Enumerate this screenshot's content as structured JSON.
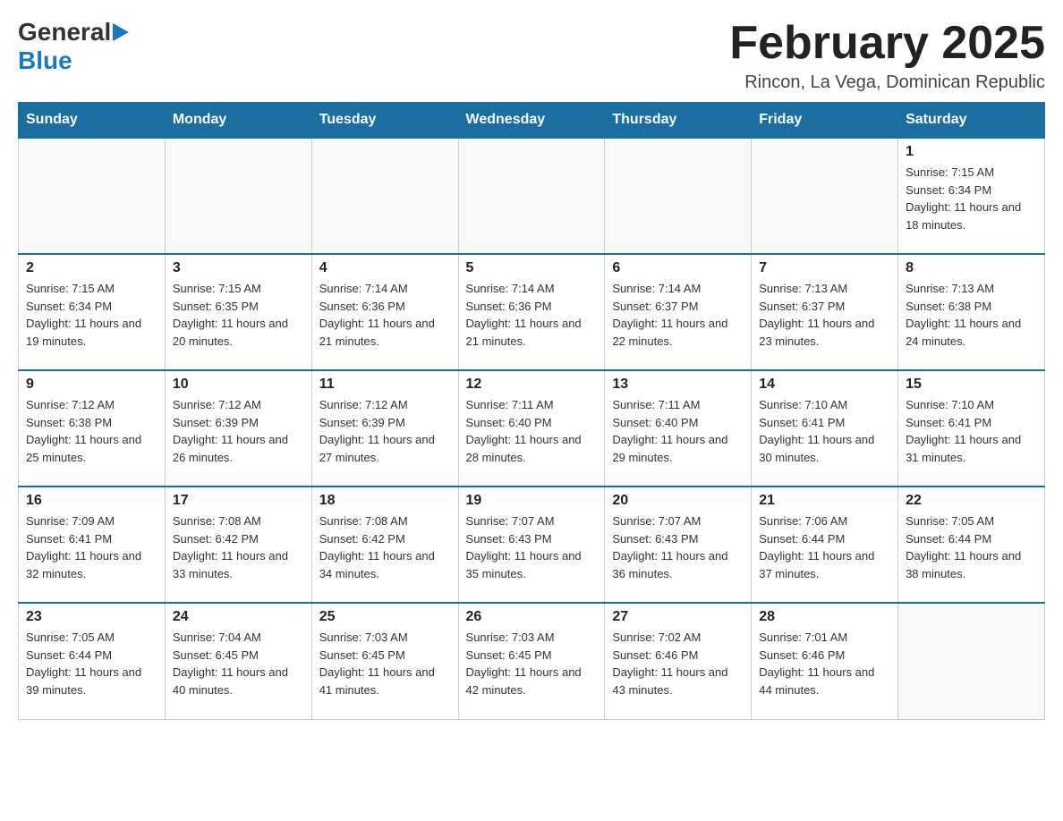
{
  "header": {
    "logo_general": "General",
    "logo_blue": "Blue",
    "main_title": "February 2025",
    "subtitle": "Rincon, La Vega, Dominican Republic"
  },
  "calendar": {
    "days_of_week": [
      "Sunday",
      "Monday",
      "Tuesday",
      "Wednesday",
      "Thursday",
      "Friday",
      "Saturday"
    ],
    "weeks": [
      [
        {
          "day": "",
          "sunrise": "",
          "sunset": "",
          "daylight": ""
        },
        {
          "day": "",
          "sunrise": "",
          "sunset": "",
          "daylight": ""
        },
        {
          "day": "",
          "sunrise": "",
          "sunset": "",
          "daylight": ""
        },
        {
          "day": "",
          "sunrise": "",
          "sunset": "",
          "daylight": ""
        },
        {
          "day": "",
          "sunrise": "",
          "sunset": "",
          "daylight": ""
        },
        {
          "day": "",
          "sunrise": "",
          "sunset": "",
          "daylight": ""
        },
        {
          "day": "1",
          "sunrise": "Sunrise: 7:15 AM",
          "sunset": "Sunset: 6:34 PM",
          "daylight": "Daylight: 11 hours and 18 minutes."
        }
      ],
      [
        {
          "day": "2",
          "sunrise": "Sunrise: 7:15 AM",
          "sunset": "Sunset: 6:34 PM",
          "daylight": "Daylight: 11 hours and 19 minutes."
        },
        {
          "day": "3",
          "sunrise": "Sunrise: 7:15 AM",
          "sunset": "Sunset: 6:35 PM",
          "daylight": "Daylight: 11 hours and 20 minutes."
        },
        {
          "day": "4",
          "sunrise": "Sunrise: 7:14 AM",
          "sunset": "Sunset: 6:36 PM",
          "daylight": "Daylight: 11 hours and 21 minutes."
        },
        {
          "day": "5",
          "sunrise": "Sunrise: 7:14 AM",
          "sunset": "Sunset: 6:36 PM",
          "daylight": "Daylight: 11 hours and 21 minutes."
        },
        {
          "day": "6",
          "sunrise": "Sunrise: 7:14 AM",
          "sunset": "Sunset: 6:37 PM",
          "daylight": "Daylight: 11 hours and 22 minutes."
        },
        {
          "day": "7",
          "sunrise": "Sunrise: 7:13 AM",
          "sunset": "Sunset: 6:37 PM",
          "daylight": "Daylight: 11 hours and 23 minutes."
        },
        {
          "day": "8",
          "sunrise": "Sunrise: 7:13 AM",
          "sunset": "Sunset: 6:38 PM",
          "daylight": "Daylight: 11 hours and 24 minutes."
        }
      ],
      [
        {
          "day": "9",
          "sunrise": "Sunrise: 7:12 AM",
          "sunset": "Sunset: 6:38 PM",
          "daylight": "Daylight: 11 hours and 25 minutes."
        },
        {
          "day": "10",
          "sunrise": "Sunrise: 7:12 AM",
          "sunset": "Sunset: 6:39 PM",
          "daylight": "Daylight: 11 hours and 26 minutes."
        },
        {
          "day": "11",
          "sunrise": "Sunrise: 7:12 AM",
          "sunset": "Sunset: 6:39 PM",
          "daylight": "Daylight: 11 hours and 27 minutes."
        },
        {
          "day": "12",
          "sunrise": "Sunrise: 7:11 AM",
          "sunset": "Sunset: 6:40 PM",
          "daylight": "Daylight: 11 hours and 28 minutes."
        },
        {
          "day": "13",
          "sunrise": "Sunrise: 7:11 AM",
          "sunset": "Sunset: 6:40 PM",
          "daylight": "Daylight: 11 hours and 29 minutes."
        },
        {
          "day": "14",
          "sunrise": "Sunrise: 7:10 AM",
          "sunset": "Sunset: 6:41 PM",
          "daylight": "Daylight: 11 hours and 30 minutes."
        },
        {
          "day": "15",
          "sunrise": "Sunrise: 7:10 AM",
          "sunset": "Sunset: 6:41 PM",
          "daylight": "Daylight: 11 hours and 31 minutes."
        }
      ],
      [
        {
          "day": "16",
          "sunrise": "Sunrise: 7:09 AM",
          "sunset": "Sunset: 6:41 PM",
          "daylight": "Daylight: 11 hours and 32 minutes."
        },
        {
          "day": "17",
          "sunrise": "Sunrise: 7:08 AM",
          "sunset": "Sunset: 6:42 PM",
          "daylight": "Daylight: 11 hours and 33 minutes."
        },
        {
          "day": "18",
          "sunrise": "Sunrise: 7:08 AM",
          "sunset": "Sunset: 6:42 PM",
          "daylight": "Daylight: 11 hours and 34 minutes."
        },
        {
          "day": "19",
          "sunrise": "Sunrise: 7:07 AM",
          "sunset": "Sunset: 6:43 PM",
          "daylight": "Daylight: 11 hours and 35 minutes."
        },
        {
          "day": "20",
          "sunrise": "Sunrise: 7:07 AM",
          "sunset": "Sunset: 6:43 PM",
          "daylight": "Daylight: 11 hours and 36 minutes."
        },
        {
          "day": "21",
          "sunrise": "Sunrise: 7:06 AM",
          "sunset": "Sunset: 6:44 PM",
          "daylight": "Daylight: 11 hours and 37 minutes."
        },
        {
          "day": "22",
          "sunrise": "Sunrise: 7:05 AM",
          "sunset": "Sunset: 6:44 PM",
          "daylight": "Daylight: 11 hours and 38 minutes."
        }
      ],
      [
        {
          "day": "23",
          "sunrise": "Sunrise: 7:05 AM",
          "sunset": "Sunset: 6:44 PM",
          "daylight": "Daylight: 11 hours and 39 minutes."
        },
        {
          "day": "24",
          "sunrise": "Sunrise: 7:04 AM",
          "sunset": "Sunset: 6:45 PM",
          "daylight": "Daylight: 11 hours and 40 minutes."
        },
        {
          "day": "25",
          "sunrise": "Sunrise: 7:03 AM",
          "sunset": "Sunset: 6:45 PM",
          "daylight": "Daylight: 11 hours and 41 minutes."
        },
        {
          "day": "26",
          "sunrise": "Sunrise: 7:03 AM",
          "sunset": "Sunset: 6:45 PM",
          "daylight": "Daylight: 11 hours and 42 minutes."
        },
        {
          "day": "27",
          "sunrise": "Sunrise: 7:02 AM",
          "sunset": "Sunset: 6:46 PM",
          "daylight": "Daylight: 11 hours and 43 minutes."
        },
        {
          "day": "28",
          "sunrise": "Sunrise: 7:01 AM",
          "sunset": "Sunset: 6:46 PM",
          "daylight": "Daylight: 11 hours and 44 minutes."
        },
        {
          "day": "",
          "sunrise": "",
          "sunset": "",
          "daylight": ""
        }
      ]
    ]
  }
}
